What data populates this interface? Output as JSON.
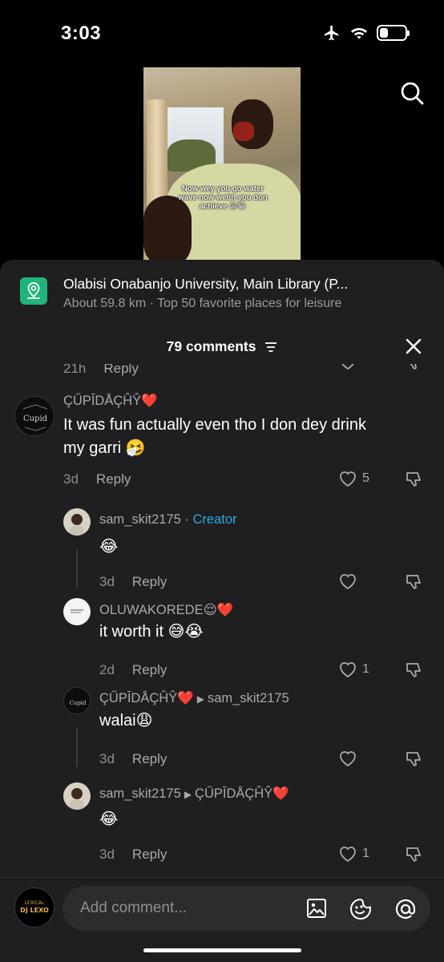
{
  "status": {
    "time": "3:03",
    "battery_level": 0.3,
    "icons": [
      "airplane-icon",
      "wifi-icon",
      "battery-icon"
    ]
  },
  "video": {
    "caption_line1": "Now wey you go water",
    "caption_line2": "wave now wetin you don",
    "caption_line3": "achieve 😩😂"
  },
  "place": {
    "title": "Olabisi Onabanjo University, Main Library (P...",
    "subtitle": "About 59.8 km · Top 50 favorite places for leisure"
  },
  "comments_header": {
    "count_label": "79 comments"
  },
  "partial_row": {
    "age": "21h",
    "reply": "Reply"
  },
  "comments": [
    {
      "username": "ÇŰPĪDÅÇĤŶ❤️",
      "text_line1": "It was fun actually even tho I don dey drink",
      "text_line2": "my garri 🤧",
      "age": "3d",
      "reply": "Reply",
      "likes": "5"
    },
    {
      "username": "sam_skit2175",
      "separator": " · ",
      "badge": "Creator",
      "text": "😂",
      "age": "3d",
      "reply": "Reply",
      "likes": ""
    },
    {
      "username": "OLUWAKOREDE😌❤️",
      "text": "it worth it 😅😭",
      "age": "2d",
      "reply": "Reply",
      "likes": "1"
    },
    {
      "username": "ÇŰPĪDÅÇĤŶ❤️",
      "reply_to": "sam_skit2175",
      "text": "walai😩",
      "age": "3d",
      "reply": "Reply",
      "likes": ""
    },
    {
      "username": "sam_skit2175",
      "reply_to": "ÇŰPĪDÅÇĤŶ❤️",
      "text": "😂",
      "age": "3d",
      "reply": "Reply",
      "likes": "1"
    }
  ],
  "composer": {
    "placeholder": "Add comment...",
    "avatar_text_top": "LEXICAL",
    "avatar_text_bottom": "DJ LEXO"
  }
}
